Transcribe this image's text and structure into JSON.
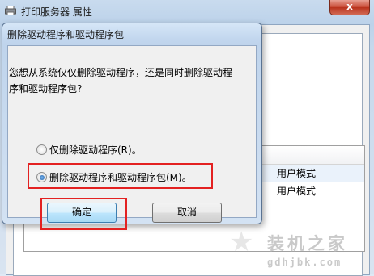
{
  "background_window": {
    "title": "打印服务器 属性",
    "close_label": "x",
    "list_rows": [
      {
        "mode": "用户模式"
      },
      {
        "mode": "用户模式"
      }
    ]
  },
  "dialog": {
    "title": "删除驱动程序和驱动程序包",
    "message_line1": "您想从系统仅仅删除驱动程序，还是同时删除驱动程",
    "message_line2": "序和驱动程序包?",
    "options": [
      {
        "label": "仅删除驱动程序(R)。",
        "checked": false
      },
      {
        "label": "删除驱动程序和驱动程序包(M)。",
        "checked": true
      }
    ],
    "ok_label": "确定",
    "cancel_label": "取消"
  },
  "watermark": {
    "brand": "装机之家",
    "url": "gdhjbk.com"
  },
  "colors": {
    "highlight": "#e32121",
    "title_bar": "#bcd2ea"
  }
}
